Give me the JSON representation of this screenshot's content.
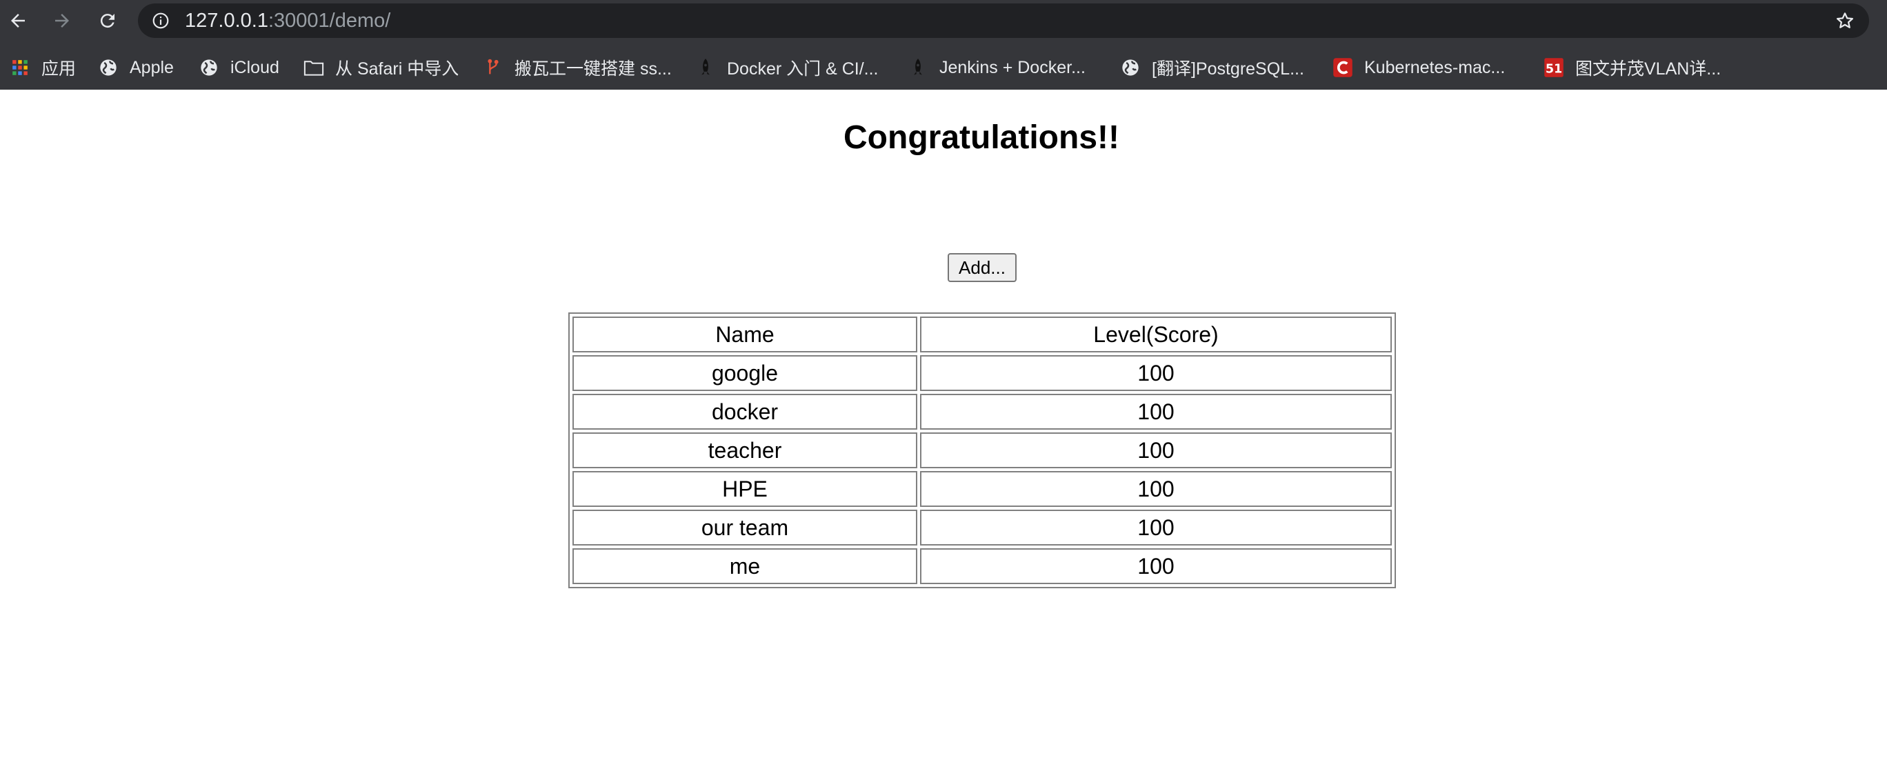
{
  "browser": {
    "url_host": "127.0.0.1",
    "url_rest": ":30001/demo/",
    "nav": {
      "back_icon": "arrow-left-icon",
      "forward_icon": "arrow-right-icon",
      "reload_icon": "reload-icon",
      "info_icon": "info-icon",
      "bookmark_star_icon": "star-icon"
    },
    "bookmarks": [
      {
        "label": "应用",
        "icon": "apps-grid-icon"
      },
      {
        "label": "Apple",
        "icon": "globe-icon"
      },
      {
        "label": "iCloud",
        "icon": "globe-icon"
      },
      {
        "label": "从 Safari 中导入",
        "icon": "folder-icon"
      },
      {
        "label": "搬瓦工一键搭建 ss...",
        "icon": "git-branch-icon"
      },
      {
        "label": "Docker 入门 & CI/...",
        "icon": "rocket-icon"
      },
      {
        "label": "Jenkins + Docker...",
        "icon": "rocket-icon"
      },
      {
        "label": "[翻译]PostgreSQL...",
        "icon": "globe-icon"
      },
      {
        "label": "Kubernetes-mac...",
        "icon": "c-logo-icon"
      },
      {
        "label": "图文并茂VLAN详...",
        "icon": "51cto-logo-icon"
      }
    ]
  },
  "page": {
    "title": "Congratulations!!",
    "add_button_label": "Add...",
    "table": {
      "headers": [
        "Name",
        "Level(Score)"
      ],
      "rows": [
        [
          "google",
          "100"
        ],
        [
          "docker",
          "100"
        ],
        [
          "teacher",
          "100"
        ],
        [
          "HPE",
          "100"
        ],
        [
          "our team",
          "100"
        ],
        [
          "me",
          "100"
        ]
      ]
    }
  },
  "colors": {
    "browser_chrome": "#35363a",
    "omnibox": "#202124",
    "chrome_text": "#e8eaed",
    "url_dim_text": "#9aa0a6"
  }
}
